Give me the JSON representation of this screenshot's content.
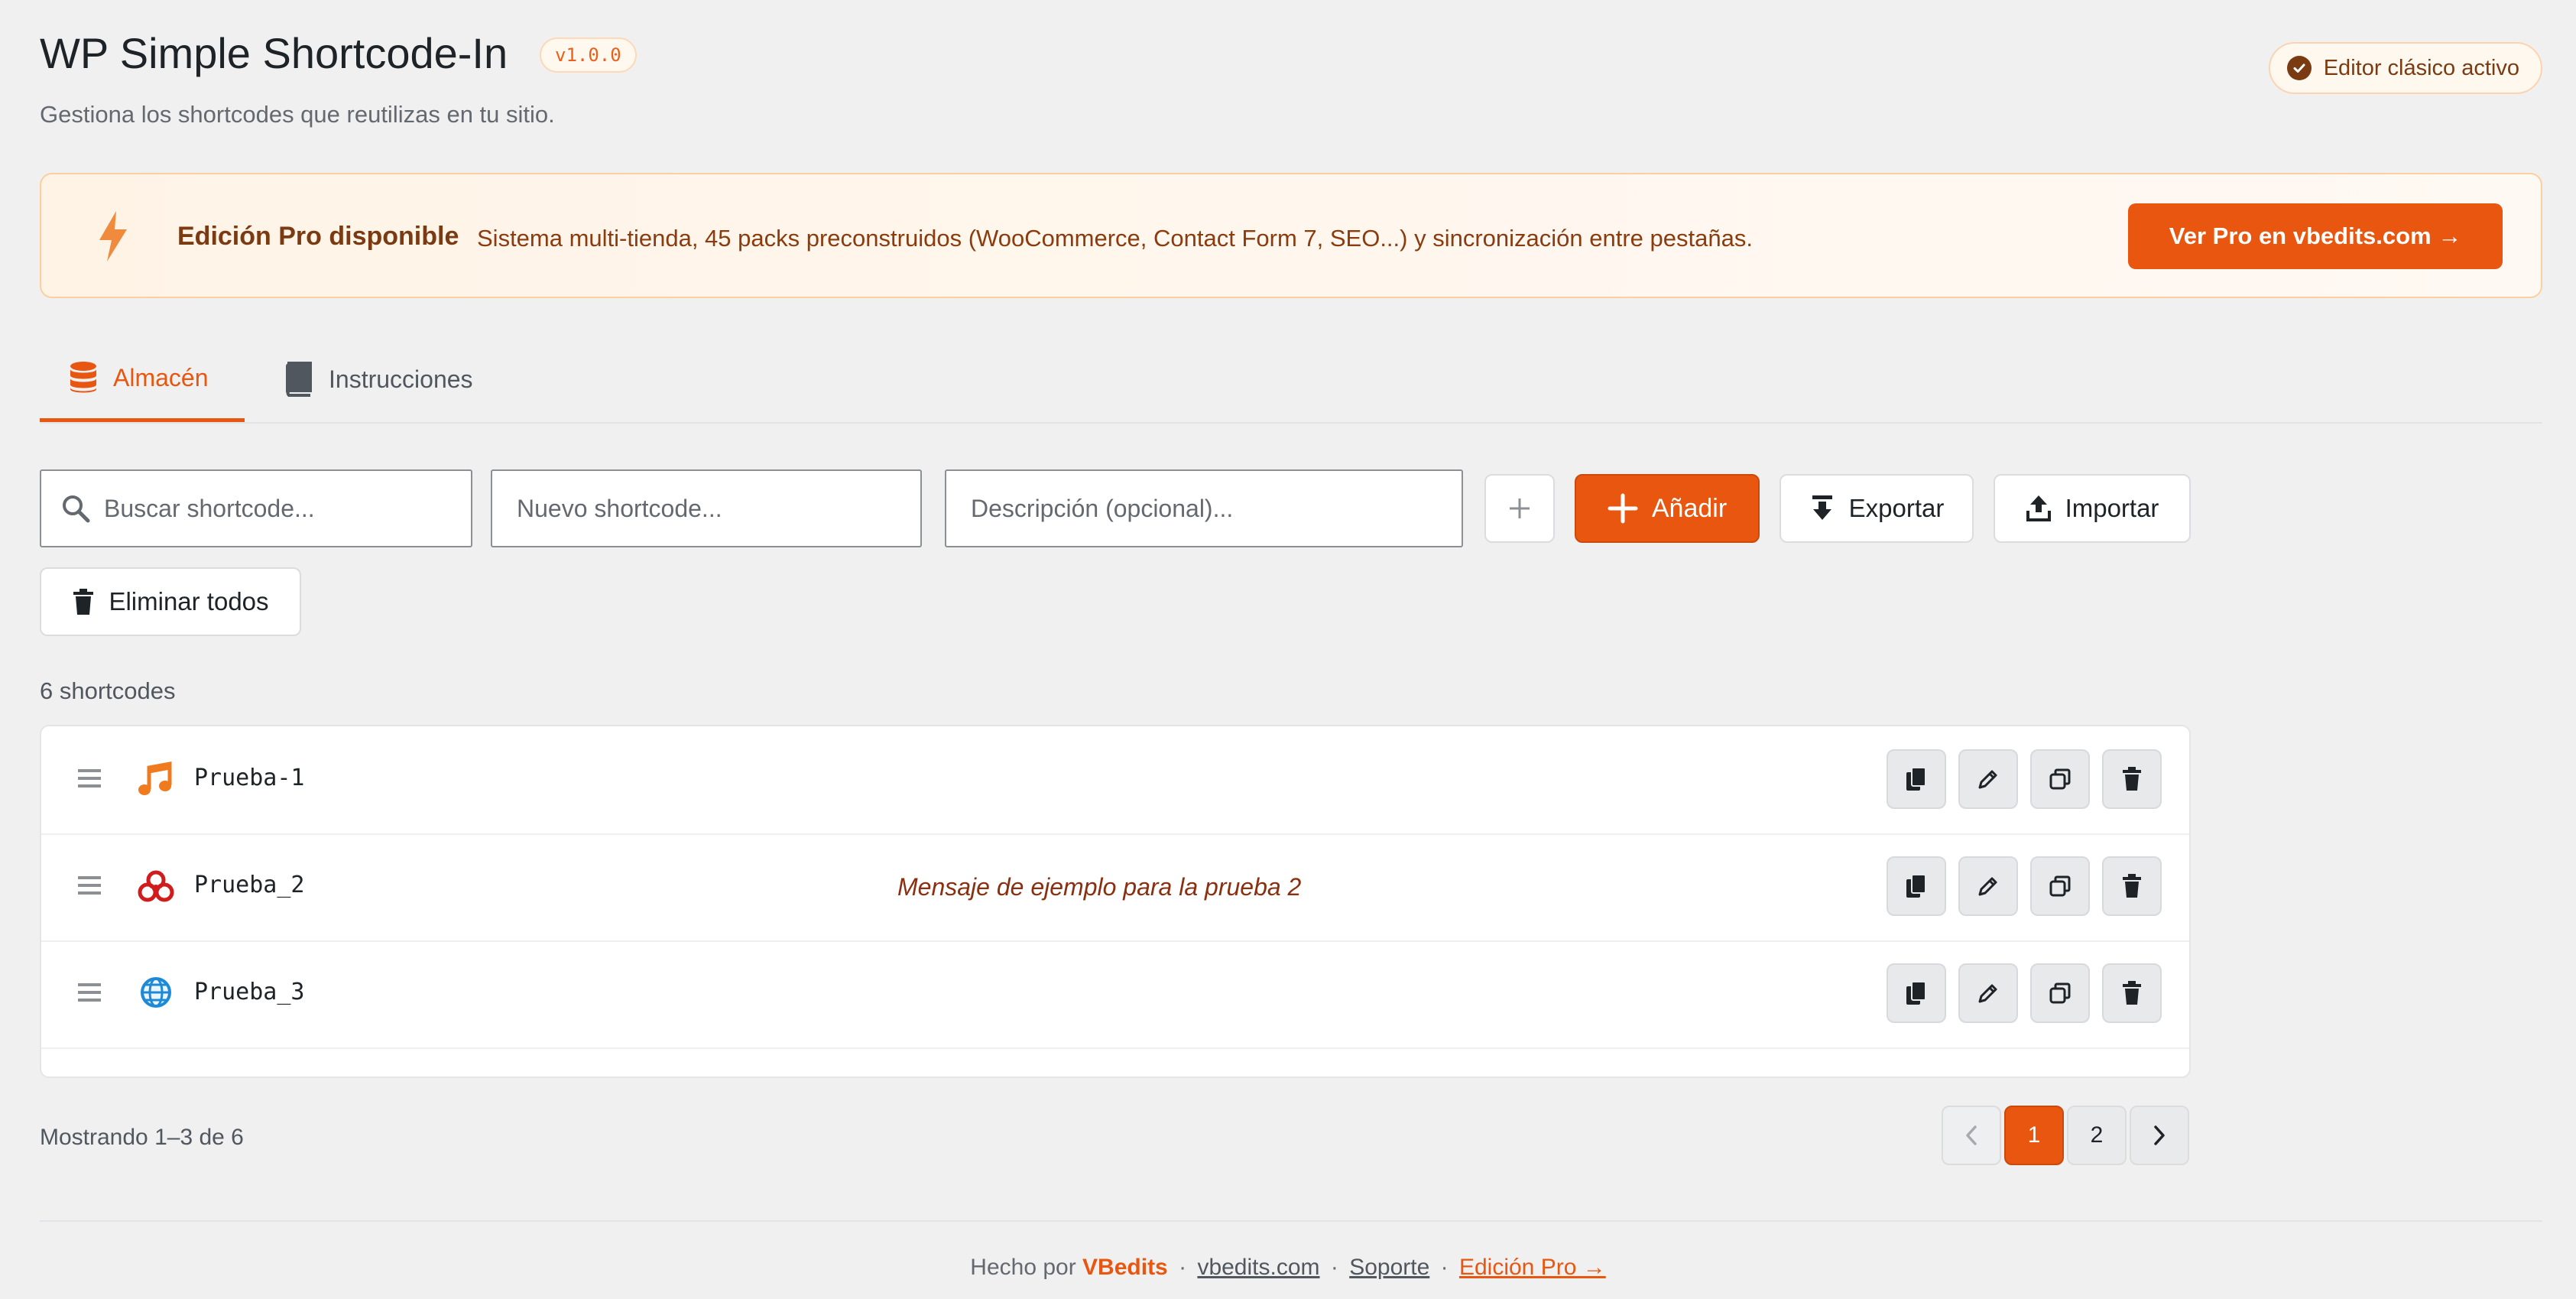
{
  "header": {
    "title": "WP Simple Shortcode-In",
    "version": "v1.0.0",
    "subtitle": "Gestiona los shortcodes que reutilizas en tu sitio.",
    "editor_status": "Editor clásico activo"
  },
  "pro_banner": {
    "title": "Edición Pro disponible",
    "description": "Sistema multi-tienda, 45 packs preconstruidos (WooCommerce, Contact Form 7, SEO...) y sincronización entre pestañas.",
    "button_label": "Ver Pro en vbedits.com →"
  },
  "tabs": [
    {
      "label": "Almacén",
      "icon": "database-icon",
      "active": true
    },
    {
      "label": "Instrucciones",
      "icon": "book-icon",
      "active": false
    }
  ],
  "toolbar": {
    "search_placeholder": "Buscar shortcode...",
    "new_placeholder": "Nuevo shortcode...",
    "description_placeholder": "Descripción (opcional)...",
    "add_label": "Añadir",
    "export_label": "Exportar",
    "import_label": "Importar",
    "delete_all_label": "Eliminar todos"
  },
  "list": {
    "count_label": "6 shortcodes",
    "items": [
      {
        "name": "Prueba-1",
        "description": "",
        "icon": "music-note-icon"
      },
      {
        "name": "Prueba_2",
        "description": "Mensaje de ejemplo para la prueba 2",
        "icon": "biohazard-icon"
      },
      {
        "name": "Prueba_3",
        "description": "",
        "icon": "globe-icon"
      }
    ]
  },
  "pagination": {
    "showing": "Mostrando 1–3 de 6",
    "pages": [
      "1",
      "2"
    ],
    "current": "1"
  },
  "footer": {
    "made_by": "Hecho por",
    "brand": "VBedits",
    "site_link": "vbedits.com",
    "support_link": "Soporte",
    "pro_link": "Edición Pro →"
  },
  "colors": {
    "accent": "#e8560f",
    "background": "#f0f0f1",
    "banner_bg": "#fff3e6",
    "description_text": "#8a2f10"
  }
}
